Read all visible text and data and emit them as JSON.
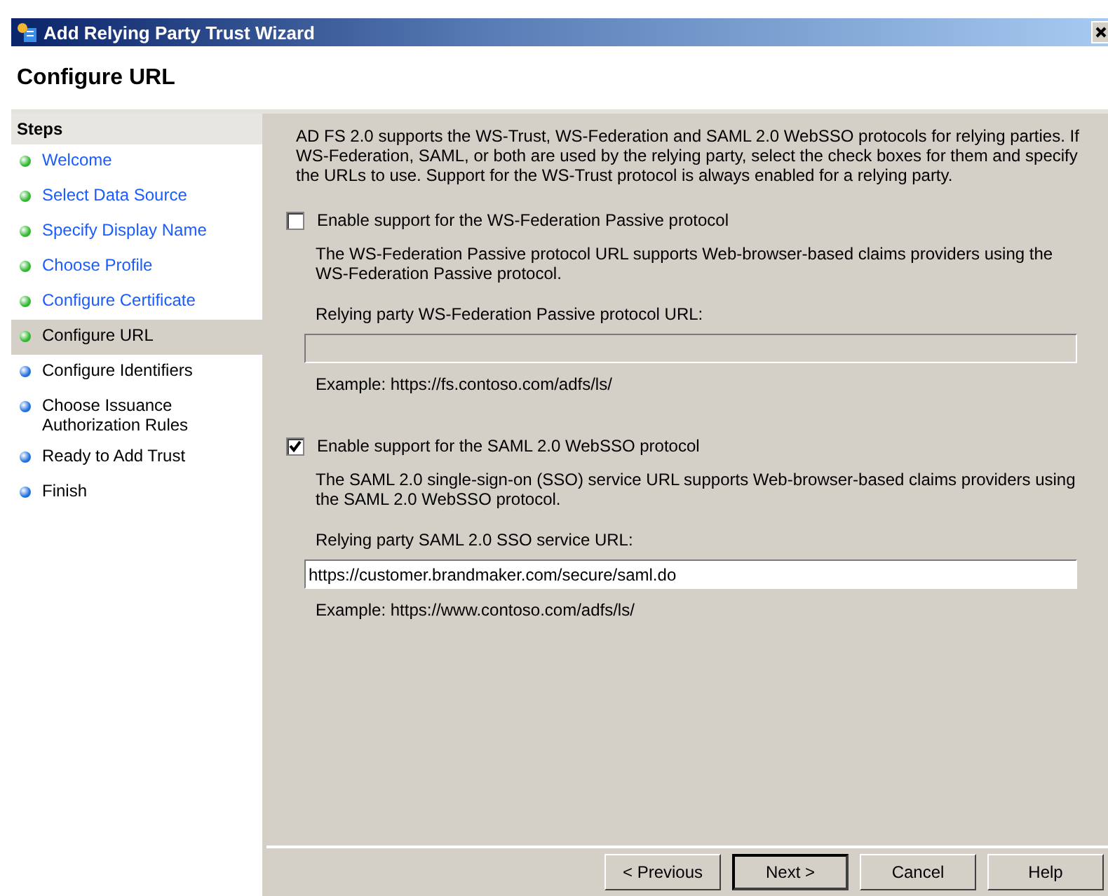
{
  "window": {
    "title": "Add Relying Party Trust Wizard"
  },
  "header": {
    "title": "Configure URL"
  },
  "steps": {
    "title": "Steps",
    "items": [
      {
        "label": "Welcome",
        "completed": true,
        "selected": false
      },
      {
        "label": "Select Data Source",
        "completed": true,
        "selected": false
      },
      {
        "label": "Specify Display Name",
        "completed": true,
        "selected": false
      },
      {
        "label": "Choose Profile",
        "completed": true,
        "selected": false
      },
      {
        "label": "Configure Certificate",
        "completed": true,
        "selected": false
      },
      {
        "label": "Configure URL",
        "completed": true,
        "selected": true
      },
      {
        "label": "Configure Identifiers",
        "completed": false,
        "selected": false
      },
      {
        "label": "Choose Issuance Authorization Rules",
        "completed": false,
        "selected": false
      },
      {
        "label": "Ready to Add Trust",
        "completed": false,
        "selected": false
      },
      {
        "label": "Finish",
        "completed": false,
        "selected": false
      }
    ]
  },
  "intro": "AD FS 2.0 supports the WS-Trust, WS-Federation and SAML 2.0 WebSSO protocols for relying parties.  If WS-Federation, SAML, or both are used by the relying party, select the check boxes for them and specify the URLs to use.  Support for the WS-Trust protocol is always enabled for a relying party.",
  "protocols": [
    {
      "label": "Enable support for the WS-Federation Passive protocol",
      "checked": false,
      "description": "The WS-Federation Passive protocol URL supports Web-browser-based claims providers using the WS-Federation Passive protocol.",
      "field_label": "Relying party WS-Federation Passive protocol URL:",
      "disabled": true,
      "example": "Example: https://fs.contoso.com/adfs/ls/"
    },
    {
      "label": "Enable support for the SAML 2.0 WebSSO protocol",
      "checked": true,
      "description": "The SAML 2.0 single-sign-on (SSO) service URL supports Web-browser-based claims providers using the SAML 2.0 WebSSO protocol.",
      "field_label": "Relying party SAML 2.0 SSO service URL:",
      "value": "https://customer.brandmaker.com/secure/saml.do",
      "disabled": false,
      "example": "Example: https://www.contoso.com/adfs/ls/"
    }
  ],
  "buttons": [
    {
      "label": "< Previous",
      "default": false
    },
    {
      "label": "Next >",
      "default": true
    },
    {
      "label": "Cancel",
      "default": false
    },
    {
      "label": "Help",
      "default": false
    }
  ]
}
